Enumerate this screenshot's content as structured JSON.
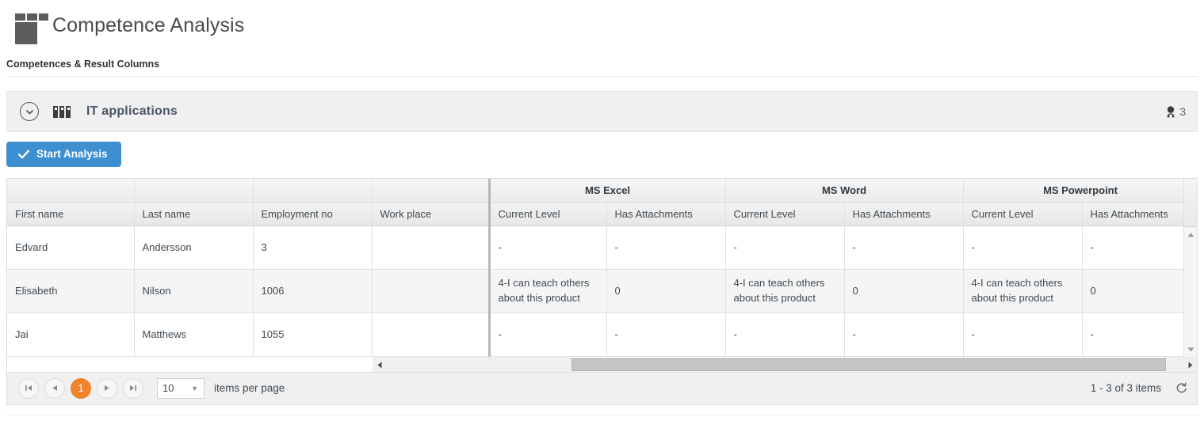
{
  "header": {
    "title": "Competence Analysis",
    "logo_icon": "grid-blocks-logo-icon"
  },
  "section": {
    "title": "Competences & Result Columns"
  },
  "panel": {
    "collapse_icon": "chevron-down-circle-icon",
    "group_icon": "servers-icon",
    "title": "IT applications",
    "people_icon": "person-icon",
    "people_count": "3"
  },
  "toolbar": {
    "start_analysis_label": "Start Analysis",
    "start_analysis_icon": "check-icon",
    "accent_color": "#3e8fd0"
  },
  "grid": {
    "group_headers": [
      "",
      "",
      "",
      "",
      "MS Excel",
      "MS Word",
      "MS Powerpoint"
    ],
    "columns": [
      "First name",
      "Last name",
      "Employment no",
      "Work place",
      "Current Level",
      "Has Attachments",
      "Current Level",
      "Has Attachments",
      "Current Level",
      "Has Attachments"
    ],
    "rows": [
      {
        "first_name": "Edvard",
        "last_name": "Andersson",
        "employment_no": "3",
        "work_place": "",
        "excel_level": "-",
        "excel_attachments": "-",
        "word_level": "-",
        "word_attachments": "-",
        "ppt_level": "-",
        "ppt_attachments": "-"
      },
      {
        "first_name": "Elisabeth",
        "last_name": "Nilson",
        "employment_no": "1006",
        "work_place": "",
        "excel_level": "4-I can teach others about this product",
        "excel_attachments": "0",
        "word_level": "4-I can teach others about this product",
        "word_attachments": "0",
        "ppt_level": "4-I can teach others about this product",
        "ppt_attachments": "0"
      },
      {
        "first_name": "Jai",
        "last_name": "Matthews",
        "employment_no": "1055",
        "work_place": "",
        "excel_level": "-",
        "excel_attachments": "-",
        "word_level": "-",
        "word_attachments": "-",
        "ppt_level": "-",
        "ppt_attachments": "-"
      }
    ]
  },
  "pager": {
    "first_icon": "first-page-icon",
    "prev_icon": "previous-page-icon",
    "current_page": "1",
    "next_icon": "next-page-icon",
    "last_icon": "last-page-icon",
    "page_size": "10",
    "page_size_caret_icon": "chevron-down-icon",
    "items_per_page_label": "items per page",
    "item_range_label": "1 - 3 of 3 items",
    "refresh_icon": "refresh-icon",
    "active_color": "#f0842a"
  },
  "scrollbars": {
    "h_left_icon": "scroll-left-icon",
    "h_right_icon": "scroll-right-icon",
    "v_up_icon": "scroll-up-icon",
    "v_down_icon": "scroll-down-icon"
  }
}
